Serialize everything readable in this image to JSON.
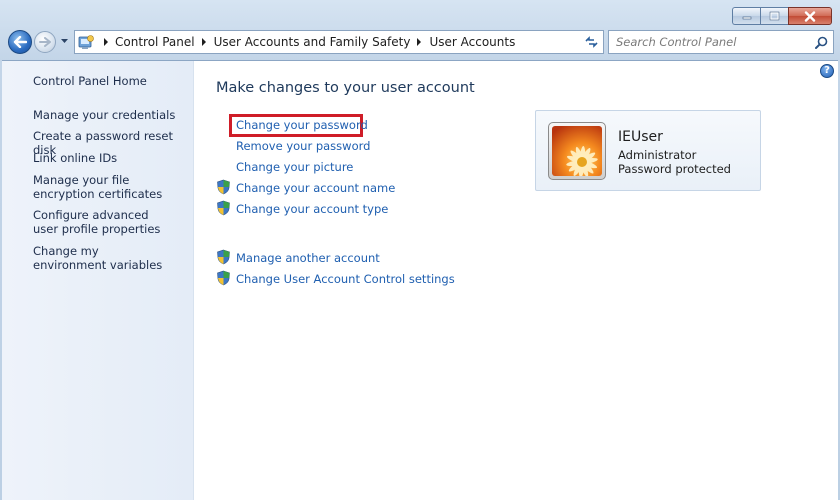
{
  "window": {
    "caption": {
      "minimize": "minimize",
      "maximize": "maximize",
      "close": "close"
    }
  },
  "address": {
    "breadcrumbs": [
      "Control Panel",
      "User Accounts and Family Safety",
      "User Accounts"
    ]
  },
  "search": {
    "placeholder": "Search Control Panel"
  },
  "sidebar": {
    "home": "Control Panel Home",
    "items": [
      "Manage your credentials",
      "Create a password reset disk",
      "Link online IDs",
      "Manage your file encryption certificates",
      "Configure advanced user profile properties",
      "Change my environment variables"
    ]
  },
  "main": {
    "title": "Make changes to your user account",
    "links": [
      {
        "label": "Change your password",
        "shield": false
      },
      {
        "label": "Remove your password",
        "shield": false
      },
      {
        "label": "Change your picture",
        "shield": false
      },
      {
        "label": "Change your account name",
        "shield": true
      },
      {
        "label": "Change your account type",
        "shield": true
      }
    ],
    "other_links": [
      {
        "label": "Manage another account",
        "shield": true
      },
      {
        "label": "Change User Account Control settings",
        "shield": true
      }
    ]
  },
  "user": {
    "name": "IEUser",
    "role": "Administrator",
    "status": "Password protected"
  },
  "colors": {
    "link": "#1f5fb0",
    "highlight": "#cf1d28",
    "title": "#1e395b"
  }
}
